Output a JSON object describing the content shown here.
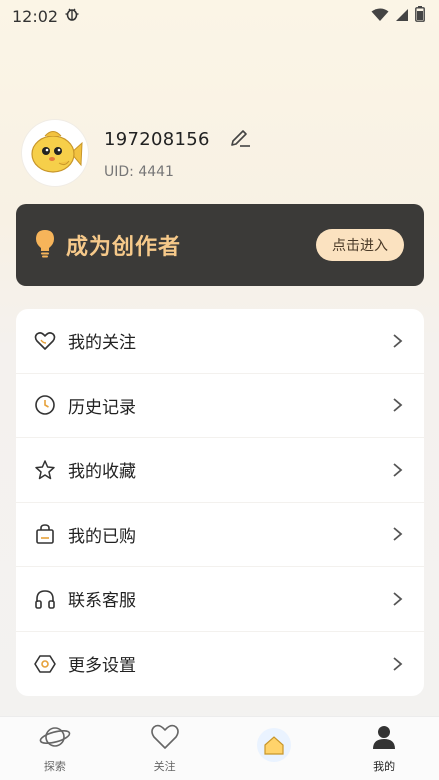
{
  "status_bar": {
    "time": "12:02",
    "notification_icon": "bug-icon",
    "wifi_icon": "wifi-icon",
    "signal_icon": "signal-icon",
    "battery_icon": "battery-icon"
  },
  "profile": {
    "avatar_icon": "fish-avatar",
    "username": "197208156",
    "uid": "UID: 4441",
    "edit_icon": "edit-icon"
  },
  "creator_banner": {
    "icon": "lightbulb-icon",
    "title": "成为创作者",
    "button_label": "点击进入",
    "accent_color": "#f6c98a",
    "background_color": "#3b3a38"
  },
  "menu": {
    "items": [
      {
        "label": "我的关注",
        "icon": "heart-icon"
      },
      {
        "label": "历史记录",
        "icon": "clock-icon"
      },
      {
        "label": "我的收藏",
        "icon": "star-icon"
      },
      {
        "label": "我的已购",
        "icon": "bag-icon"
      },
      {
        "label": "联系客服",
        "icon": "headphones-icon"
      },
      {
        "label": "更多设置",
        "icon": "settings-icon"
      }
    ]
  },
  "tab_bar": {
    "tabs": [
      {
        "label": "探索",
        "icon": "planet-icon"
      },
      {
        "label": "关注",
        "icon": "heart-icon"
      },
      {
        "label": "",
        "icon": "home-icon"
      },
      {
        "label": "我的",
        "icon": "profile-icon"
      }
    ]
  }
}
